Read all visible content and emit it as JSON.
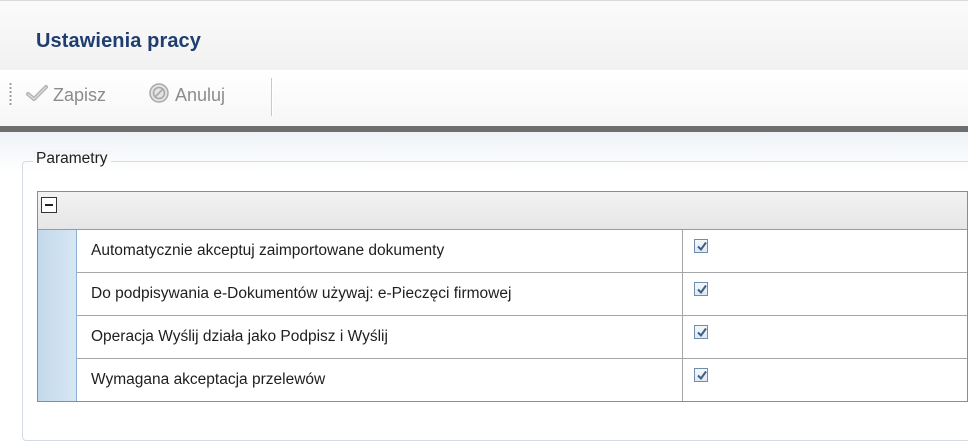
{
  "header": {
    "title": "Ustawienia pracy"
  },
  "toolbar": {
    "save_label": "Zapisz",
    "save_icon": "checkmark-icon",
    "cancel_label": "Anuluj",
    "cancel_icon": "cancel-circle-icon"
  },
  "params": {
    "legend": "Parametry",
    "rows": [
      {
        "label": "Automatycznie akceptuj zaimportowane dokumenty",
        "checked": true
      },
      {
        "label": "Do podpisywania e-Dokumentów używaj: e-Pieczęci firmowej",
        "checked": true
      },
      {
        "label": "Operacja Wyślij działa jako Podpisz i Wyślij",
        "checked": true
      },
      {
        "label": "Wymagana akceptacja przelewów",
        "checked": true
      }
    ]
  },
  "colors": {
    "title": "#1f3d6e",
    "row_indent": "#c3d9ec",
    "divider": "#6e6e6e"
  }
}
